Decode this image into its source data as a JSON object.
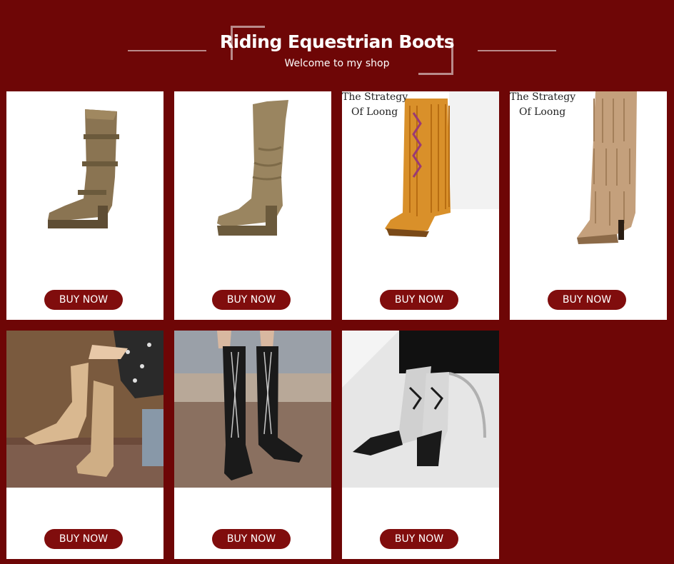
{
  "header": {
    "title": "Riding Equestrian Boots",
    "subtitle": "Welcome to my shop"
  },
  "products": [
    {
      "button_label": "BUY NOW",
      "image": "tan-suede-buckle-knee-boot"
    },
    {
      "button_label": "BUY NOW",
      "image": "tan-slouch-chelsea-tall-boot"
    },
    {
      "button_label": "BUY NOW",
      "image": "orange-fringe-moccasin-boot",
      "watermark": [
        "The Strategy",
        "Of Loong"
      ]
    },
    {
      "button_label": "BUY NOW",
      "image": "beige-tiered-fringe-heel-boot",
      "watermark": [
        "The Strategy",
        "Of Loong"
      ]
    },
    {
      "button_label": "BUY NOW",
      "image": "beige-knit-lace-up-boot-on-model"
    },
    {
      "button_label": "BUY NOW",
      "image": "black-patent-lace-up-boot-on-model"
    },
    {
      "button_label": "BUY NOW",
      "image": "black-white-western-boot-on-model"
    }
  ]
}
